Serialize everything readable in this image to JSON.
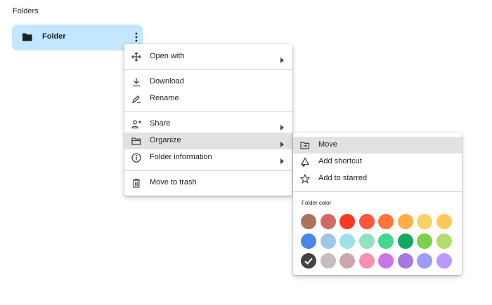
{
  "page": {
    "section_title": "Folders"
  },
  "folder": {
    "name": "Folder",
    "icon": "folder-icon",
    "more_icon": "more-vert-icon"
  },
  "context_menu": {
    "items": [
      {
        "label": "Open with",
        "icon": "open-with-icon",
        "has_submenu": true
      },
      {
        "label": "Download",
        "icon": "download-icon"
      },
      {
        "label": "Rename",
        "icon": "rename-icon"
      },
      {
        "label": "Share",
        "icon": "share-icon",
        "has_submenu": true
      },
      {
        "label": "Organize",
        "icon": "folder-open-icon",
        "has_submenu": true,
        "highlighted": true
      },
      {
        "label": "Folder information",
        "icon": "info-icon",
        "has_submenu": true
      },
      {
        "label": "Move to trash",
        "icon": "trash-icon"
      }
    ]
  },
  "organize_menu": {
    "items": [
      {
        "label": "Move",
        "icon": "move-icon",
        "highlighted": true
      },
      {
        "label": "Add shortcut",
        "icon": "add-shortcut-icon"
      },
      {
        "label": "Add to starred",
        "icon": "star-icon"
      }
    ],
    "folder_color_label": "Folder color",
    "colors": [
      [
        "#ac725e",
        "#d06b64",
        "#f83a22",
        "#fa573c",
        "#ff7537",
        "#ffad46",
        "#fad165",
        "#ffc857"
      ],
      [
        "#4986e7",
        "#9fc6e7",
        "#9fe1e7",
        "#92e1c0",
        "#42d692",
        "#16a765",
        "#7bd148",
        "#b3dc6c"
      ],
      [
        "#434343",
        "#cabdbf",
        "#cca6ac",
        "#f691b2",
        "#cd74e6",
        "#a47ae2",
        "#9a9cff",
        "#b99aff"
      ]
    ],
    "selected_color": "#434343"
  }
}
